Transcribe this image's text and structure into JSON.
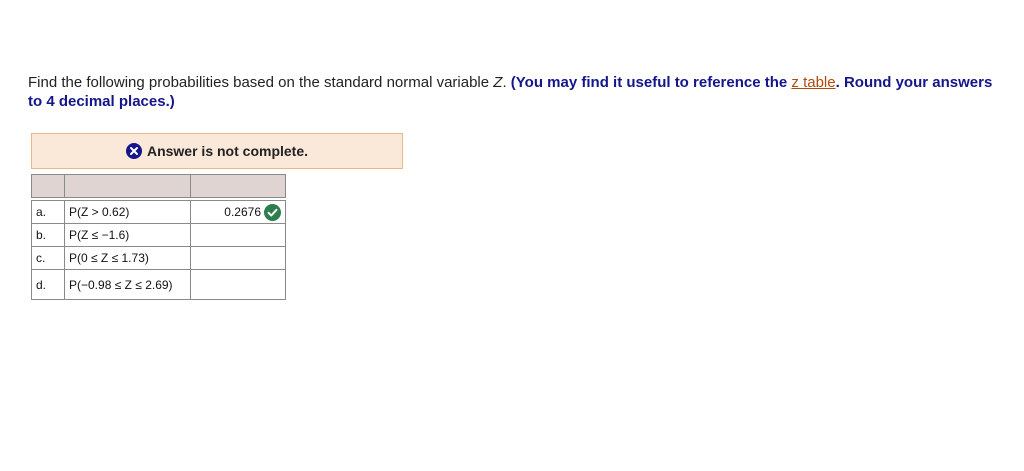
{
  "question": {
    "text_before": "Find the following probabilities based on the standard normal variable ",
    "variable": "Z",
    "text_after": ". ",
    "note_before": "(You may find it useful to reference the ",
    "link_text": "z table",
    "note_after": ". Round your answers to 4 decimal places.)"
  },
  "banner": {
    "text": "Answer is not complete.",
    "icon": "x-circle-icon",
    "icon_color": "#14168a"
  },
  "table": {
    "rows": [
      {
        "letter": "a.",
        "expression": "P(Z > 0.62)",
        "answer": "0.2676",
        "status": "correct"
      },
      {
        "letter": "b.",
        "expression": "P(Z ≤ −1.6)",
        "answer": "",
        "status": ""
      },
      {
        "letter": "c.",
        "expression": "P(0 ≤ Z ≤ 1.73)",
        "answer": "",
        "status": ""
      },
      {
        "letter": "d.",
        "expression": "P(−0.98 ≤ Z ≤ 2.69)",
        "answer": "",
        "status": ""
      }
    ],
    "correct_icon": "check-circle-icon",
    "correct_color": "#2e7d4f"
  }
}
